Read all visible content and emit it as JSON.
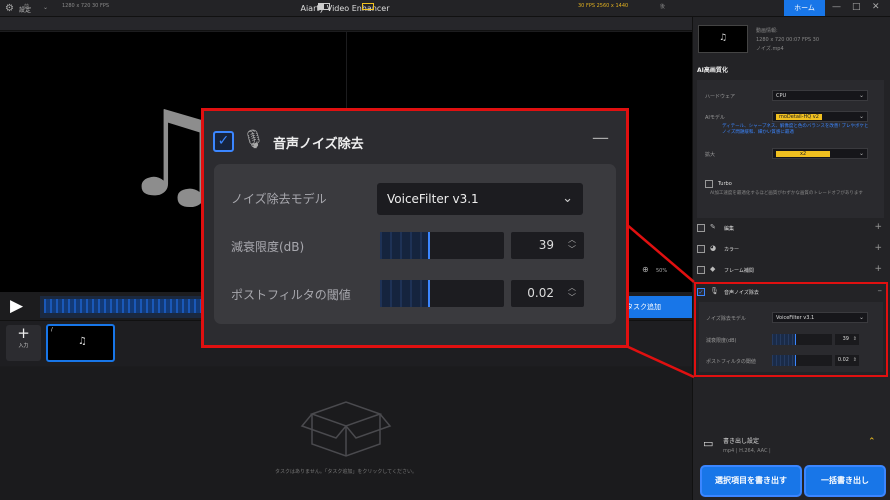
{
  "titlebar": {
    "settings_label": "設定",
    "app_title": "Aiarty Video Enhancer",
    "home_label": "ホーム",
    "min_icon": "—",
    "max_icon": "□",
    "close_icon": "✕"
  },
  "preview": {
    "before_label": "前",
    "source_info": "1280 x 720  30 FPS",
    "output_info": "30 FPS  2560 x 1440",
    "after_label": "後",
    "zoom_level": "50%",
    "add_task_label": "タスク追加"
  },
  "clipbar": {
    "add_input_label": "入力",
    "add_plus": "+"
  },
  "task_area": {
    "empty_message": "タスクはありません。「タスク追加」をクリックしてください。"
  },
  "right_panel": {
    "video_info_title": "動画情報:",
    "video_info_line1": "1280 x 720  00:07   FPS 30",
    "video_file": "ノイズ.mp4",
    "ai_section_title": "AI高画質化",
    "hardware_label": "ハードウェア",
    "hardware_value": "CPU",
    "ai_model_label": "AIモデル",
    "ai_model_value": "moDetail-HQ  v2",
    "ai_model_hint": "ディテール、シャープネス、解像度と色のバランスを改善! ブレやボケとノイズ問題緩和、細かい質感に最適",
    "scale_label": "拡大",
    "scale_value": "x2",
    "turbo_label": "Turbo",
    "turbo_hint": "AI加工速度を最適化するほど画質がわずかな画質のトレードオフがあります",
    "edit_label": "編集",
    "color_label": "カラー",
    "frame_label": "フレーム補間",
    "noise_title": "音声ノイズ除去",
    "noise_model_label": "ノイズ除去モデル",
    "noise_model_value": "VoiceFilter v3.1",
    "attenuation_label": "減衰限度(dB)",
    "attenuation_value": "39",
    "postfilter_label": "ポストフィルタの閾値",
    "postfilter_value": "0.02",
    "export_settings_label": "書き出し設定",
    "export_format": "mp4 | H.264, AAC |",
    "export_selected_label": "選択項目を書き出す",
    "export_all_label": "一括書き出し"
  },
  "callout": {
    "title": "音声ノイズ除去",
    "model_label": "ノイズ除去モデル",
    "model_value": "VoiceFilter v3.1",
    "attenuation_label": "減衰限度(dB)",
    "attenuation_value": "39",
    "postfilter_label": "ポストフィルタの閾値",
    "postfilter_value": "0.02"
  },
  "levels": {
    "attenuation_fill_fraction": 0.4,
    "postfilter_fill_fraction": 0.4,
    "timeline_progress": 1.0
  },
  "colors": {
    "accent_blue": "#1876e8",
    "highlight_red": "#e01010",
    "yellow": "#f0c020"
  },
  "icons": {
    "music_note": "♫",
    "settings": "⚙",
    "play": "▶",
    "mic": "🎙",
    "zoom": "⊕"
  }
}
